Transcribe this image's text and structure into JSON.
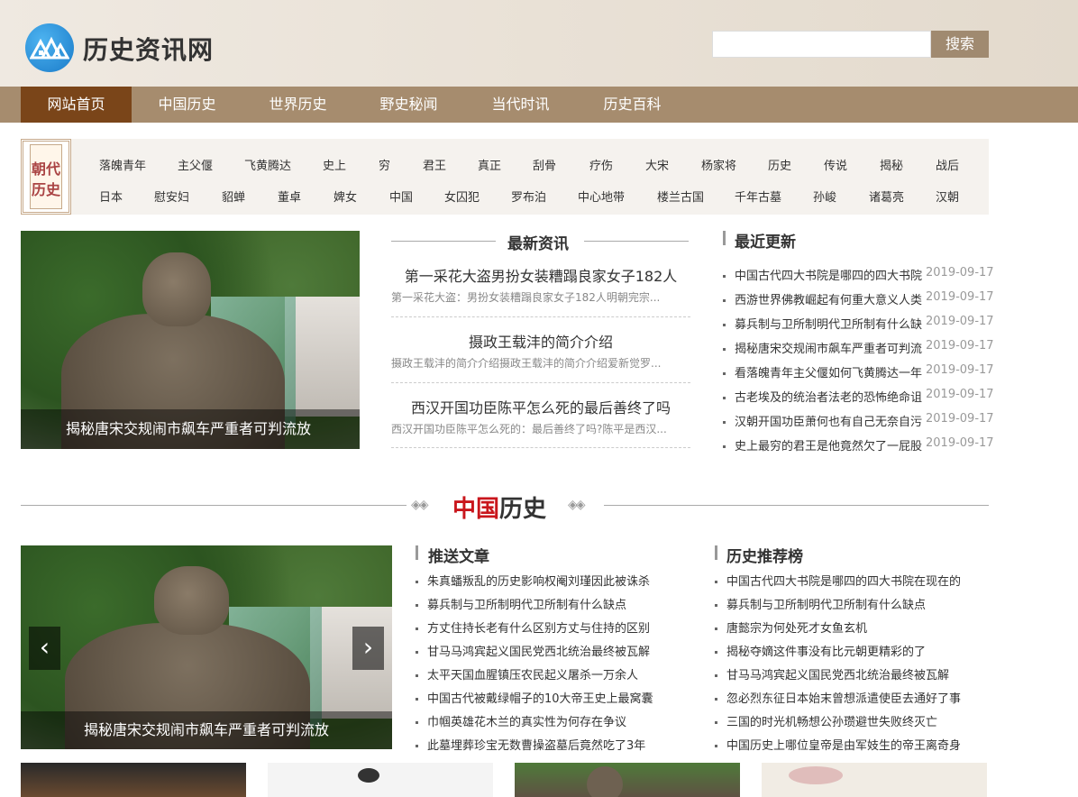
{
  "header": {
    "site_title": "历史资讯网",
    "search_placeholder": "",
    "search_button": "搜索"
  },
  "nav": [
    {
      "label": "网站首页",
      "active": true
    },
    {
      "label": "中国历史",
      "active": false
    },
    {
      "label": "世界历史",
      "active": false
    },
    {
      "label": "野史秘闻",
      "active": false
    },
    {
      "label": "当代时讯",
      "active": false
    },
    {
      "label": "历史百科",
      "active": false
    }
  ],
  "tags": {
    "icon_text": "朝代历史",
    "row1": [
      "落魄青年",
      "主父偃",
      "飞黄腾达",
      "史上",
      "穷",
      "君王",
      "真正",
      "刮骨",
      "疗伤",
      "大宋",
      "杨家将",
      "历史",
      "传说",
      "揭秘",
      "战后"
    ],
    "row2": [
      "日本",
      "慰安妇",
      "貂蝉",
      "董卓",
      "婢女",
      "中国",
      "女囚犯",
      "罗布泊",
      "中心地带",
      "楼兰古国",
      "千年古墓",
      "孙峻",
      "诸葛亮",
      "汉朝"
    ]
  },
  "hero": {
    "caption": "揭秘唐宋交规闹市飙车严重者可判流放"
  },
  "latest_news": {
    "heading": "最新资讯",
    "items": [
      {
        "title": "第一采花大盗男扮女装糟蹋良家女子182人",
        "desc": "第一采花大盗：男扮女装糟蹋良家女子182人明朝完宗..."
      },
      {
        "title": "摄政王载沣的简介介绍",
        "desc": "摄政王载沣的简介介绍摄政王载沣的简介介绍爱新觉罗..."
      },
      {
        "title": "西汉开国功臣陈平怎么死的最后善终了吗",
        "desc": "西汉开国功臣陈平怎么死的：最后善终了吗?陈平是西汉..."
      }
    ]
  },
  "recent_updates": {
    "heading": "最近更新",
    "items": [
      {
        "title": "中国古代四大书院是哪四的四大书院",
        "date": "2019-09-17"
      },
      {
        "title": "西游世界佛教崛起有何重大意义人类",
        "date": "2019-09-17"
      },
      {
        "title": "募兵制与卫所制明代卫所制有什么缺",
        "date": "2019-09-17"
      },
      {
        "title": "揭秘唐宋交规闹市飙车严重者可判流",
        "date": "2019-09-17"
      },
      {
        "title": "看落魄青年主父偃如何飞黄腾达一年",
        "date": "2019-09-17"
      },
      {
        "title": "古老埃及的统治者法老的恐怖绝命诅",
        "date": "2019-09-17"
      },
      {
        "title": "汉朝开国功臣萧何也有自己无奈自污",
        "date": "2019-09-17"
      },
      {
        "title": "史上最穷的君王是他竟然欠了一屁股",
        "date": "2019-09-17"
      }
    ]
  },
  "china_history": {
    "title_red": "中国",
    "title_dark": "历史",
    "slider_caption": "揭秘唐宋交规闹市飙车严重者可判流放",
    "prev_icon": "‹",
    "next_icon": "›"
  },
  "push_articles": {
    "heading": "推送文章",
    "items": [
      "朱真蟠叛乱的历史影响权阉刘瑾因此被诛杀",
      "募兵制与卫所制明代卫所制有什么缺点",
      "方丈住持长老有什么区别方丈与住持的区别",
      "甘马马鸿宾起义国民党西北统治最终被瓦解",
      "太平天国血腥镇压农民起义屠杀一万余人",
      "中国古代被戴绿帽子的10大帝王史上最窝囊",
      "巾帼英雄花木兰的真实性为何存在争议",
      "此墓埋葬珍宝无数曹操盗墓后竟然吃了3年"
    ]
  },
  "history_rank": {
    "heading": "历史推荐榜",
    "items": [
      "中国古代四大书院是哪四的四大书院在现在的",
      "募兵制与卫所制明代卫所制有什么缺点",
      "唐懿宗为何处死才女鱼玄机",
      "揭秘夺嫡这件事没有比元朝更精彩的了",
      "甘马马鸿宾起义国民党西北统治最终被瓦解",
      "忽必烈东征日本始末曾想派遣使臣去通好了事",
      "三国的时光机畅想公孙瓒避世失败终灭亡",
      "中国历史上哪位皇帝是由军妓生的帝王离奇身"
    ]
  }
}
